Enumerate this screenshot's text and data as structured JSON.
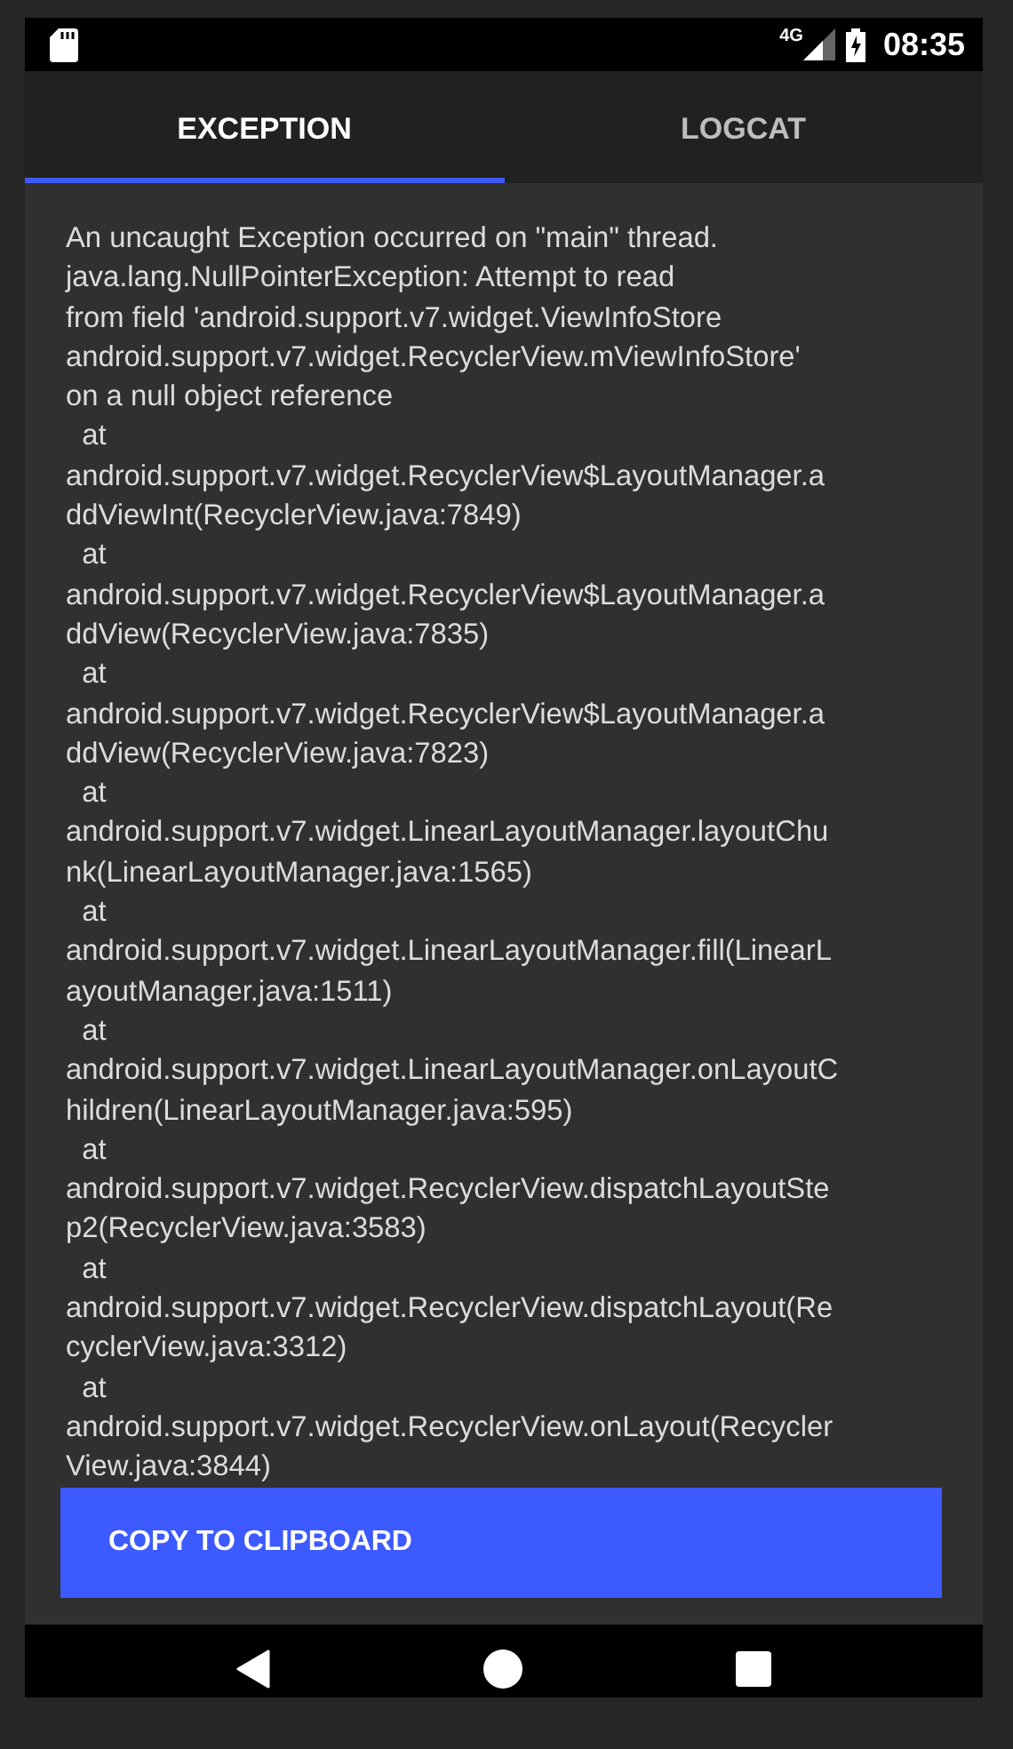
{
  "status_bar": {
    "network": "4G",
    "time": "08:35"
  },
  "tabs": [
    {
      "label": "EXCEPTION",
      "selected": true
    },
    {
      "label": "LOGCAT",
      "selected": false
    }
  ],
  "message": "An uncaught Exception occurred on \"main\" thread.\njava.lang.NullPointerException: Attempt to read\nfrom field 'android.support.v7.widget.ViewInfoStore\nandroid.support.v7.widget.RecyclerView.mViewInfoStore'\non a null object reference\n  at\nandroid.support.v7.widget.RecyclerView$LayoutManager.a\nddViewInt(RecyclerView.java:7849)\n  at\nandroid.support.v7.widget.RecyclerView$LayoutManager.a\nddView(RecyclerView.java:7835)\n  at\nandroid.support.v7.widget.RecyclerView$LayoutManager.a\nddView(RecyclerView.java:7823)\n  at\nandroid.support.v7.widget.LinearLayoutManager.layoutChu\nnk(LinearLayoutManager.java:1565)\n  at\nandroid.support.v7.widget.LinearLayoutManager.fill(LinearL\nayoutManager.java:1511)\n  at\nandroid.support.v7.widget.LinearLayoutManager.onLayoutC\nhildren(LinearLayoutManager.java:595)\n  at\nandroid.support.v7.widget.RecyclerView.dispatchLayoutSte\np2(RecyclerView.java:3583)\n  at\nandroid.support.v7.widget.RecyclerView.dispatchLayout(Re\ncyclerView.java:3312)\n  at\nandroid.support.v7.widget.RecyclerView.onLayout(Recycler\nView.java:3844)",
  "button": "COPY TO CLIPBOARD"
}
